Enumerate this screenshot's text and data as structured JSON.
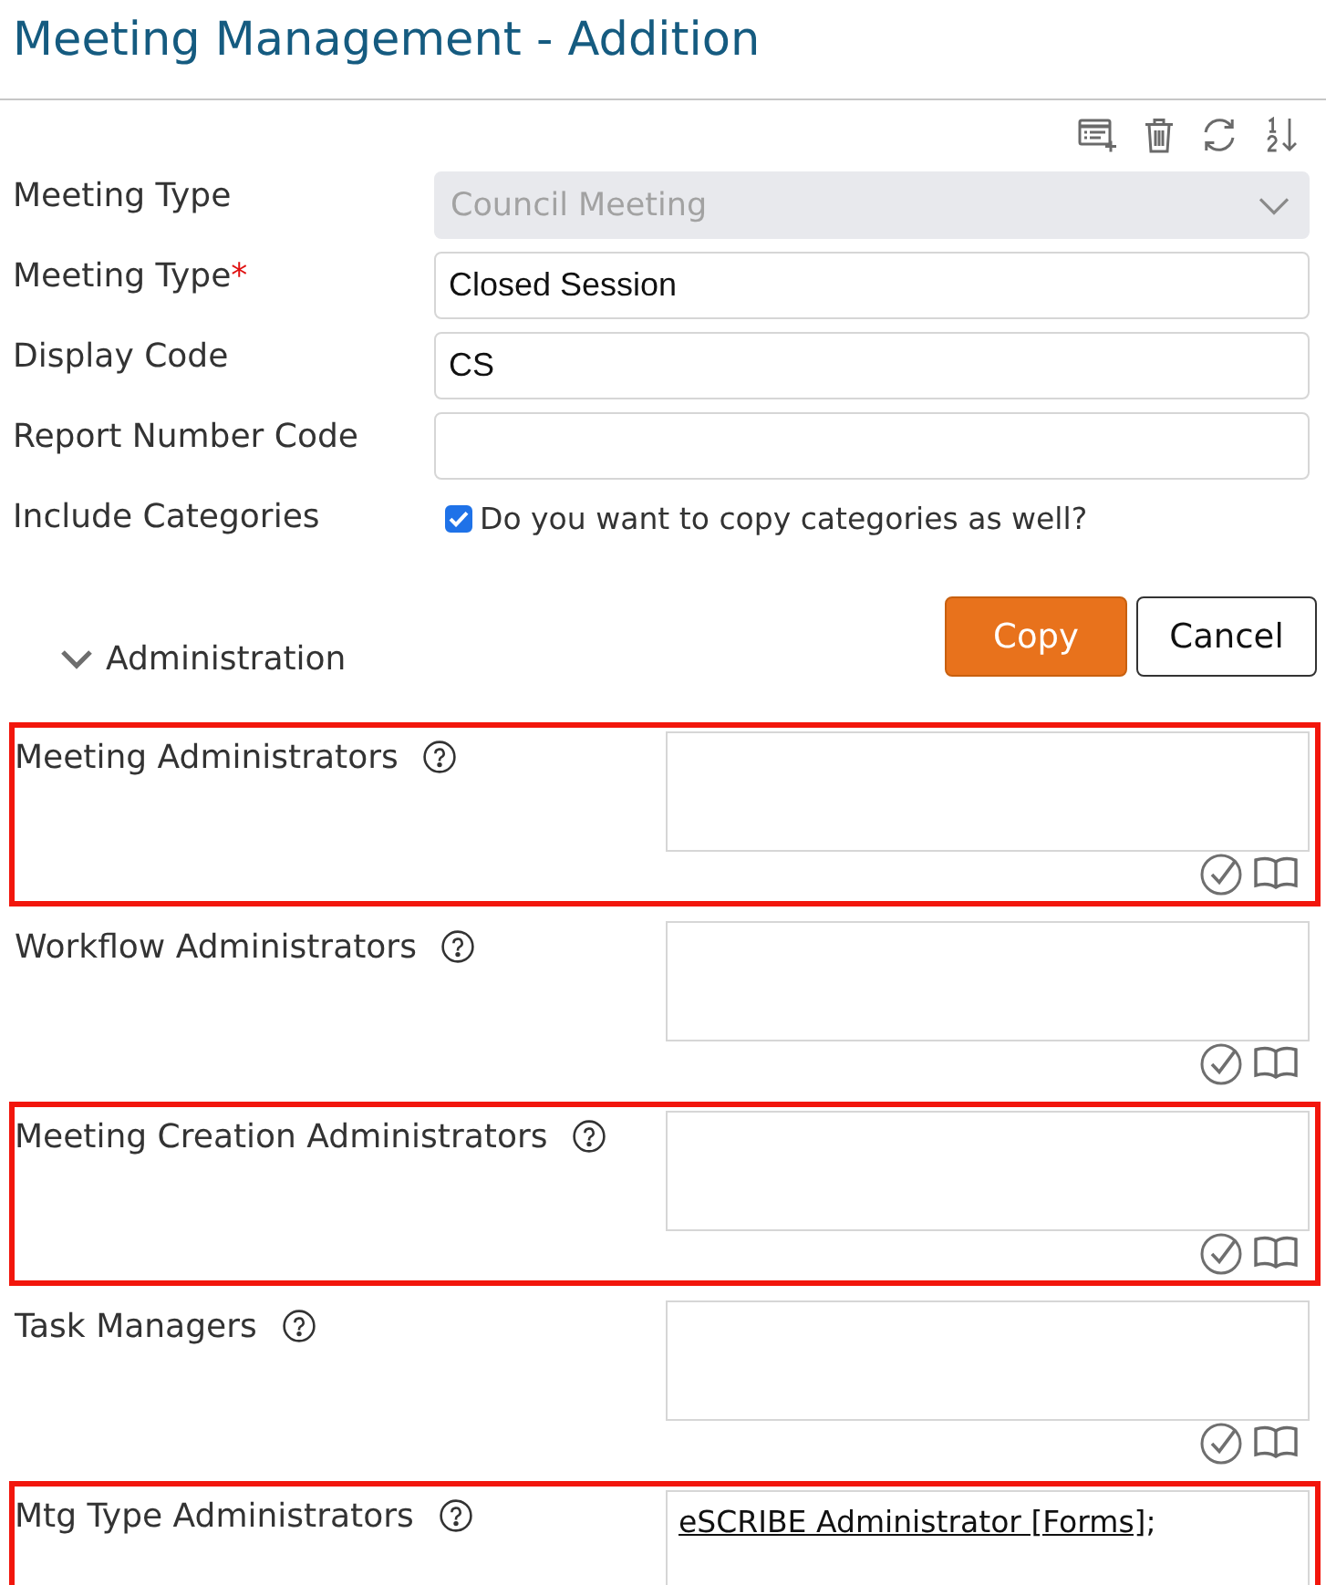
{
  "page": {
    "title": "Meeting Management - Addition"
  },
  "form": {
    "fields": [
      {
        "label": "Meeting Type",
        "kind": "select",
        "value": "Council Meeting",
        "disabled": true
      },
      {
        "label": "Meeting Type",
        "required_mark": "*",
        "kind": "text",
        "value": "Closed Session",
        "disabled": false
      },
      {
        "label": "Display Code",
        "kind": "text",
        "value": "CS",
        "disabled": false
      },
      {
        "label": "Report Number Code",
        "kind": "text",
        "disabled": false
      },
      {
        "label": "Include Categories",
        "kind": "checkbox",
        "text": "Do you want to copy categories as well?",
        "checked": true,
        "disabled": false
      }
    ]
  },
  "actions": [
    {
      "label": "Copy",
      "kind": "primary"
    },
    {
      "label": "Cancel",
      "kind": "secondary"
    }
  ],
  "administration": {
    "title": "Administration",
    "expanded": true,
    "fields": [
      {
        "label": "Meeting Administrators",
        "highlighted": true
      },
      {
        "label": "Workflow Administrators",
        "highlighted": false
      },
      {
        "label": "Meeting Creation Administrators",
        "highlighted": true
      },
      {
        "label": "Task Managers",
        "highlighted": false
      },
      {
        "label": "Mtg Type Administrators",
        "highlighted": true,
        "entries": [
          {
            "name": "eSCRIBE Administrator [Forms]",
            "separator": ";"
          }
        ]
      }
    ]
  }
}
